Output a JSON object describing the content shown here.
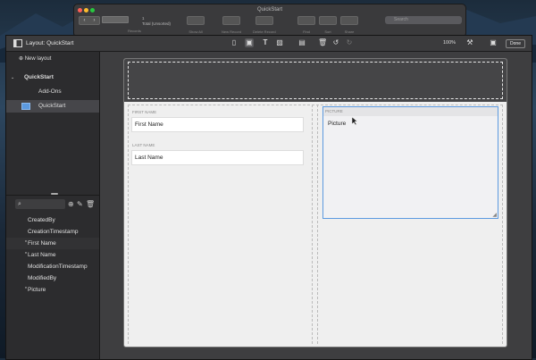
{
  "background_window": {
    "title": "QuickStart",
    "records_label": "Records",
    "record_count": "1",
    "total_label": "Total (Unsorted)",
    "toolbar": [
      "Show All",
      "New Record",
      "Delete Record",
      "Find",
      "Sort",
      "Share"
    ],
    "search_placeholder": "Search"
  },
  "main_window": {
    "title": "Layout: QuickStart",
    "zoom": "100%",
    "done_label": "Done"
  },
  "sidebar": {
    "new_layout_label": "New layout",
    "tree": [
      {
        "label": "QuickStart",
        "type": "folder",
        "expanded": true
      },
      {
        "label": "Add-Ons",
        "type": "layout"
      },
      {
        "label": "QuickStart",
        "type": "layout",
        "selected": true
      }
    ],
    "fields": [
      {
        "name": "CreatedBy",
        "required": false
      },
      {
        "name": "CreationTimestamp",
        "required": false
      },
      {
        "name": "First Name",
        "required": true
      },
      {
        "name": "Last Name",
        "required": true
      },
      {
        "name": "ModificationTimestamp",
        "required": false
      },
      {
        "name": "ModifiedBy",
        "required": false
      },
      {
        "name": "Picture",
        "required": true
      }
    ]
  },
  "layout": {
    "first_name_label": "FIRST NAME",
    "first_name_value": "First Name",
    "last_name_label": "LAST NAME",
    "last_name_value": "Last Name",
    "picture_label": "PICTURE",
    "picture_value": "Picture"
  },
  "colors": {
    "accent": "#5c9ae0",
    "toolbar": "#3b3b3d",
    "sidebar": "#2c2c2e",
    "canvas": "#efefef"
  }
}
